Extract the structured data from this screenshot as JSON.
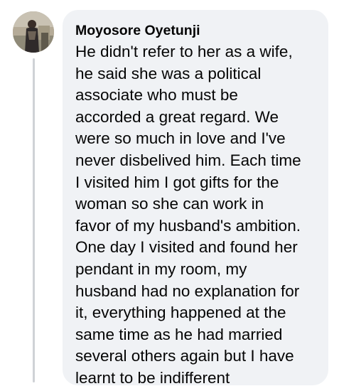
{
  "comment": {
    "author": "Moyosore Oyetunji",
    "avatar_icon": "profile-photo",
    "text_lines": [
      "He didn't refer to her as a wife,",
      "he said she was a political",
      "associate who must be",
      "accorded a great regard. We",
      "were so much in love and I've",
      "never disbelived him. Each time",
      "I visited him I got gifts for the",
      "woman so she can work in",
      "favor of my husband's ambition.",
      "One day I visited and found her",
      "pendant in my room, my",
      "husband had no explanation for",
      "it, everything happened at the",
      "same time as he had married",
      "several others again but I have",
      "learnt to be indifferent"
    ]
  },
  "colors": {
    "bubble_background": "#f0f2f5",
    "thread_line": "#cfd2d6",
    "text": "#050505"
  }
}
